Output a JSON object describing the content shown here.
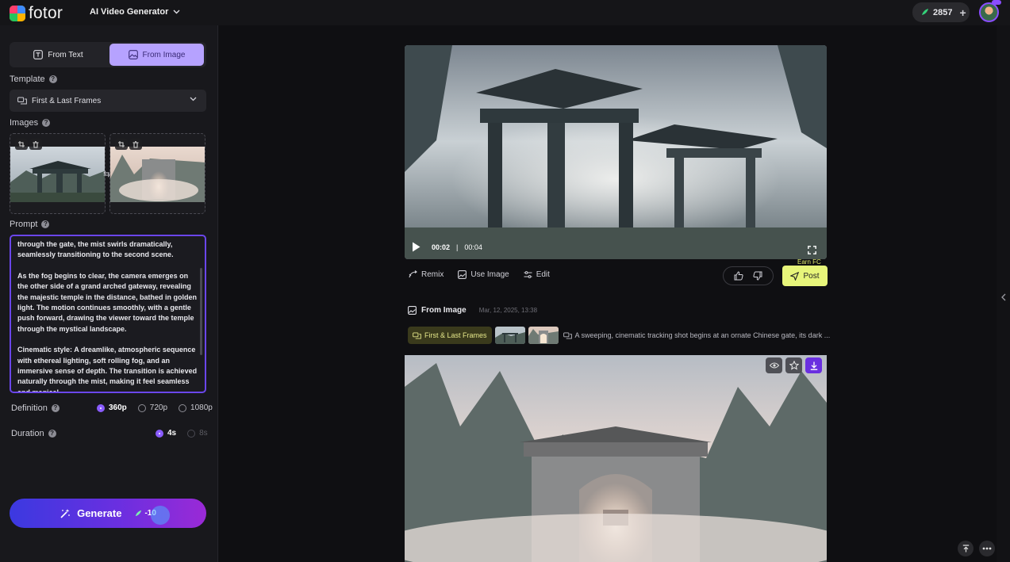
{
  "header": {
    "logo_text": "fotor",
    "app_switcher": "AI Video Generator",
    "credits": "2857"
  },
  "left": {
    "mode_tabs": [
      {
        "label": "From Text",
        "active": false
      },
      {
        "label": "From Image",
        "active": true
      }
    ],
    "template_label": "Template",
    "template_value": "First & Last Frames",
    "images_label": "Images",
    "prompt_label": "Prompt",
    "prompt_paragraphs": [
      "through the gate, the mist swirls dramatically, seamlessly transitioning to the second scene.",
      "As the fog begins to clear, the camera emerges on the other side of a grand arched gateway, revealing the majestic temple in the distance, bathed in golden light. The motion continues smoothly, with a gentle push forward, drawing the viewer toward the temple through the mystical landscape.",
      "Cinematic style: A dreamlike, atmospheric sequence with ethereal lighting, soft rolling fog, and an immersive sense of depth. The transition is achieved naturally through the mist, making it feel seamless and magical."
    ],
    "definition_label": "Definition",
    "definition_options": [
      "360p",
      "720p",
      "1080p"
    ],
    "definition_selected": "360p",
    "duration_label": "Duration",
    "duration_options": [
      "4s",
      "8s"
    ],
    "duration_selected": "4s",
    "generate_label": "Generate",
    "generate_cost": "-10"
  },
  "player": {
    "current_time": "00:02",
    "separator": "|",
    "total_time": "00:04"
  },
  "actions": {
    "remix": "Remix",
    "use_image": "Use Image",
    "edit": "Edit",
    "earn": "Earn FC",
    "post": "Post"
  },
  "history": {
    "source": "From Image",
    "date": "Mar, 12, 2025, 13:38",
    "template_tag": "First & Last Frames",
    "prompt_preview": "A sweeping, cinematic tracking shot begins at an ornate Chinese gate, its dark ..."
  },
  "colors": {
    "accent": "#8a5cff",
    "active_tab": "#b6a2ff",
    "post_button": "#e7f57a",
    "earn_text": "#dfe96a"
  }
}
